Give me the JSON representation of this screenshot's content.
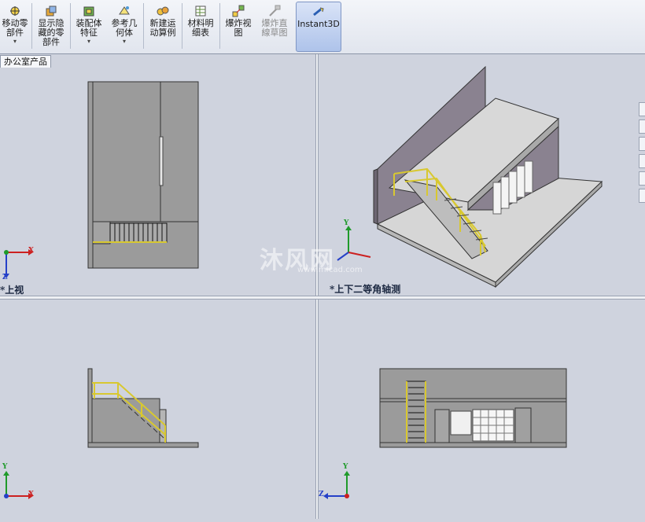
{
  "toolbar": {
    "buttons": [
      {
        "lines": [
          "移动零",
          "部件"
        ],
        "dropdown": true
      },
      {
        "lines": [
          "显示隐",
          "藏的零",
          "部件"
        ],
        "dropdown": false
      },
      {
        "lines": [
          "装配体",
          "特征"
        ],
        "dropdown": true
      },
      {
        "lines": [
          "参考几",
          "何体"
        ],
        "dropdown": true
      },
      {
        "lines": [
          "新建运",
          "动算例"
        ],
        "dropdown": false
      },
      {
        "lines": [
          "材料明",
          "细表"
        ],
        "dropdown": false
      },
      {
        "lines": [
          "爆炸视",
          "图"
        ],
        "dropdown": false
      },
      {
        "lines": [
          "爆炸直",
          "線草图"
        ],
        "dropdown": false,
        "disabled": true
      },
      {
        "lines": [
          "Instant3D"
        ],
        "dropdown": false,
        "active": true
      }
    ],
    "dropdown_glyph": "▾"
  },
  "tree_tab": "办公室产品",
  "window_controls": {
    "minimize": "–",
    "restore": "🗗",
    "close": "×"
  },
  "viewports": {
    "top_left_label": "*上视",
    "top_right_label": "*上下二等角轴测",
    "bottom_left_label": "",
    "bottom_right_label": ""
  },
  "axes": {
    "x": "X",
    "y": "Y",
    "z": "Z"
  },
  "watermark": {
    "main": "沐风网",
    "sub": "www.mfcad.com"
  },
  "colors": {
    "viewport_bg": "#cfd3de",
    "model_gray": "#9b9b9b",
    "wall": "#8a8290",
    "floor": "#d6d6d6",
    "rail_yellow": "#d8c830",
    "axis_x": "#cc2020",
    "axis_y": "#1f9a2a",
    "axis_z": "#2540c8"
  },
  "hud_icons": [
    "zoom-fit-icon",
    "zoom-area-icon",
    "previous-view-icon",
    "section-view-icon",
    "view-orientation-icon",
    "display-style-icon",
    "hide-show-icon",
    "edit-appearance-icon",
    "apply-scene-icon",
    "view-settings-icon"
  ]
}
